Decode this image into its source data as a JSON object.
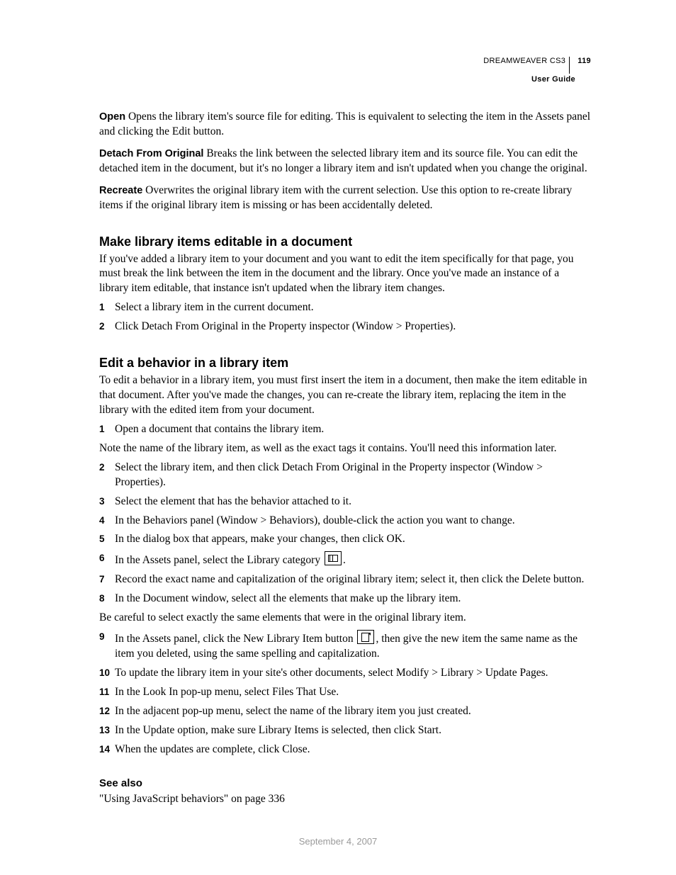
{
  "header": {
    "doc_title": "DREAMWEAVER CS3",
    "page_number": "119",
    "subtitle": "User Guide"
  },
  "definitions": [
    {
      "term": "Open",
      "text": "Opens the library item's source file for editing. This is equivalent to selecting the item in the Assets panel and clicking the Edit button."
    },
    {
      "term": "Detach From Original",
      "text": "Breaks the link between the selected library item and its source file. You can edit the detached item in the document, but it's no longer a library item and isn't updated when you change the original."
    },
    {
      "term": "Recreate",
      "text": "Overwrites the original library item with the current selection. Use this option to re-create library items if the original library item is missing or has been accidentally deleted."
    }
  ],
  "section1": {
    "heading": "Make library items editable in a document",
    "intro": "If you've added a library item to your document and you want to edit the item specifically for that page, you must break the link between the item in the document and the library. Once you've made an instance of a library item editable, that instance isn't updated when the library item changes.",
    "steps": [
      "Select a library item in the current document.",
      "Click Detach From Original in the Property inspector (Window > Properties)."
    ]
  },
  "section2": {
    "heading": "Edit a behavior in a library item",
    "intro": "To edit a behavior in a library item, you must first insert the item in a document, then make the item editable in that document. After you've made the changes, you can re-create the library item, replacing the item in the library with the edited item from your document.",
    "step1": "Open a document that contains the library item.",
    "note1": "Note the name of the library item, as well as the exact tags it contains. You'll need this information later.",
    "step2": "Select the library item, and then click Detach From Original in the Property inspector (Window > Properties).",
    "step3": "Select the element that has the behavior attached to it.",
    "step4": "In the Behaviors panel (Window > Behaviors), double-click the action you want to change.",
    "step5": "In the dialog box that appears, make your changes, then click OK.",
    "step6_pre": "In the Assets panel, select the Library category ",
    "step6_post": ".",
    "step7": "Record the exact name and capitalization of the original library item; select it, then click the Delete button.",
    "step8": "In the Document window, select all the elements that make up the library item.",
    "note2": "Be careful to select exactly the same elements that were in the original library item.",
    "step9_pre": "In the Assets panel, click the New Library Item button ",
    "step9_post": ", then give the new item the same name as the item you deleted, using the same spelling and capitalization.",
    "step10": "To update the library item in your site's other documents, select Modify > Library > Update Pages.",
    "step11": "In the Look In pop-up menu, select Files That Use.",
    "step12": "In the adjacent pop-up menu, select the name of the library item you just created.",
    "step13": "In the Update option, make sure Library Items is selected, then click Start.",
    "step14": "When the updates are complete, click Close."
  },
  "seealso": {
    "heading": "See also",
    "link": "\"Using JavaScript behaviors\" on page 336"
  },
  "footer_date": "September 4, 2007",
  "nums": {
    "n1": "1",
    "n2": "2",
    "n3": "3",
    "n4": "4",
    "n5": "5",
    "n6": "6",
    "n7": "7",
    "n8": "8",
    "n9": "9",
    "n10": "10",
    "n11": "11",
    "n12": "12",
    "n13": "13",
    "n14": "14"
  }
}
